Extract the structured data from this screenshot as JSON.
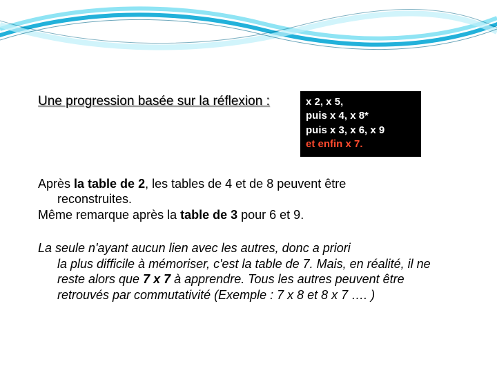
{
  "heading": "Une progression basée sur la réflexion :",
  "badge": {
    "line1": "x 2, x 5,",
    "line2_a": "puis x 4, ",
    "line2_b": "x 8*",
    "line3_a": "puis x 3, ",
    "line3_b": "x 6, x 9",
    "line4": "et enfin x 7."
  },
  "para1": {
    "t1": "Après ",
    "t2": "la table de 2",
    "t3": ", les tables de 4 et de 8 peuvent être ",
    "t4": "reconstruites.",
    "t5": "Même remarque après la ",
    "t6": "table de 3 ",
    "t7": "pour 6 et 9."
  },
  "para2": {
    "t1": "La seule n'ayant aucun lien avec les autres, donc a  priori ",
    "t2": "la plus difficile à mémoriser, c'est la table de 7. Mais, en réalité, il ne reste alors que ",
    "t3": "7 x 7",
    "t4": " à apprendre. Tous les autres peuvent être retrouvés par commutativité (Exemple : 7 x 8 et 8 x 7 …. )"
  }
}
